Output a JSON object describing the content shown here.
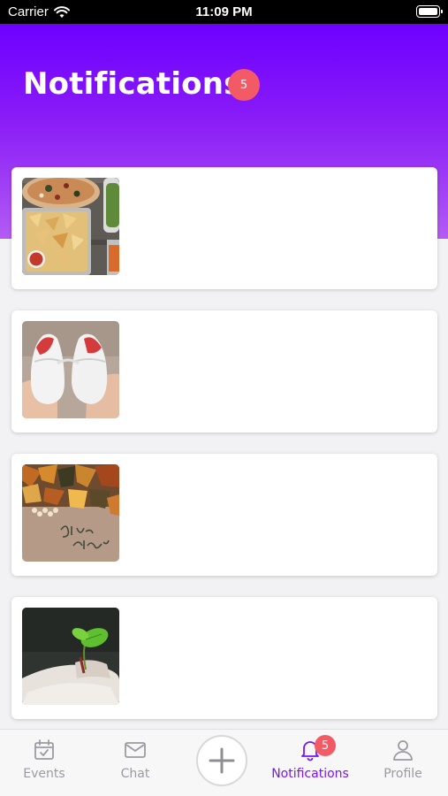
{
  "status_bar": {
    "carrier": "Carrier",
    "time": "11:09 PM",
    "icons": [
      "wifi-icon",
      "battery-icon"
    ]
  },
  "header": {
    "title": "Notifications",
    "badge_count": "5",
    "gradient_colors": [
      "#6d00ff",
      "#b35cf3"
    ]
  },
  "notifications": [
    {
      "thumbnail": "food-platter-image"
    },
    {
      "thumbnail": "baby-shoes-image"
    },
    {
      "thumbnail": "give-thanks-autumn-leaves-image"
    },
    {
      "thumbnail": "sprout-in-hands-image"
    }
  ],
  "tab_bar": {
    "tabs": [
      {
        "label": "Events",
        "icon": "calendar-check-icon"
      },
      {
        "label": "Chat",
        "icon": "envelope-icon"
      },
      {
        "label": "",
        "icon": "plus-icon"
      },
      {
        "label": "Notifications",
        "icon": "bell-icon",
        "badge": "5",
        "active": true
      },
      {
        "label": "Profile",
        "icon": "person-icon"
      }
    ],
    "active_color": "#7b14f7",
    "inactive_color": "#9a9aa2",
    "badge_color": "#f25a66"
  }
}
